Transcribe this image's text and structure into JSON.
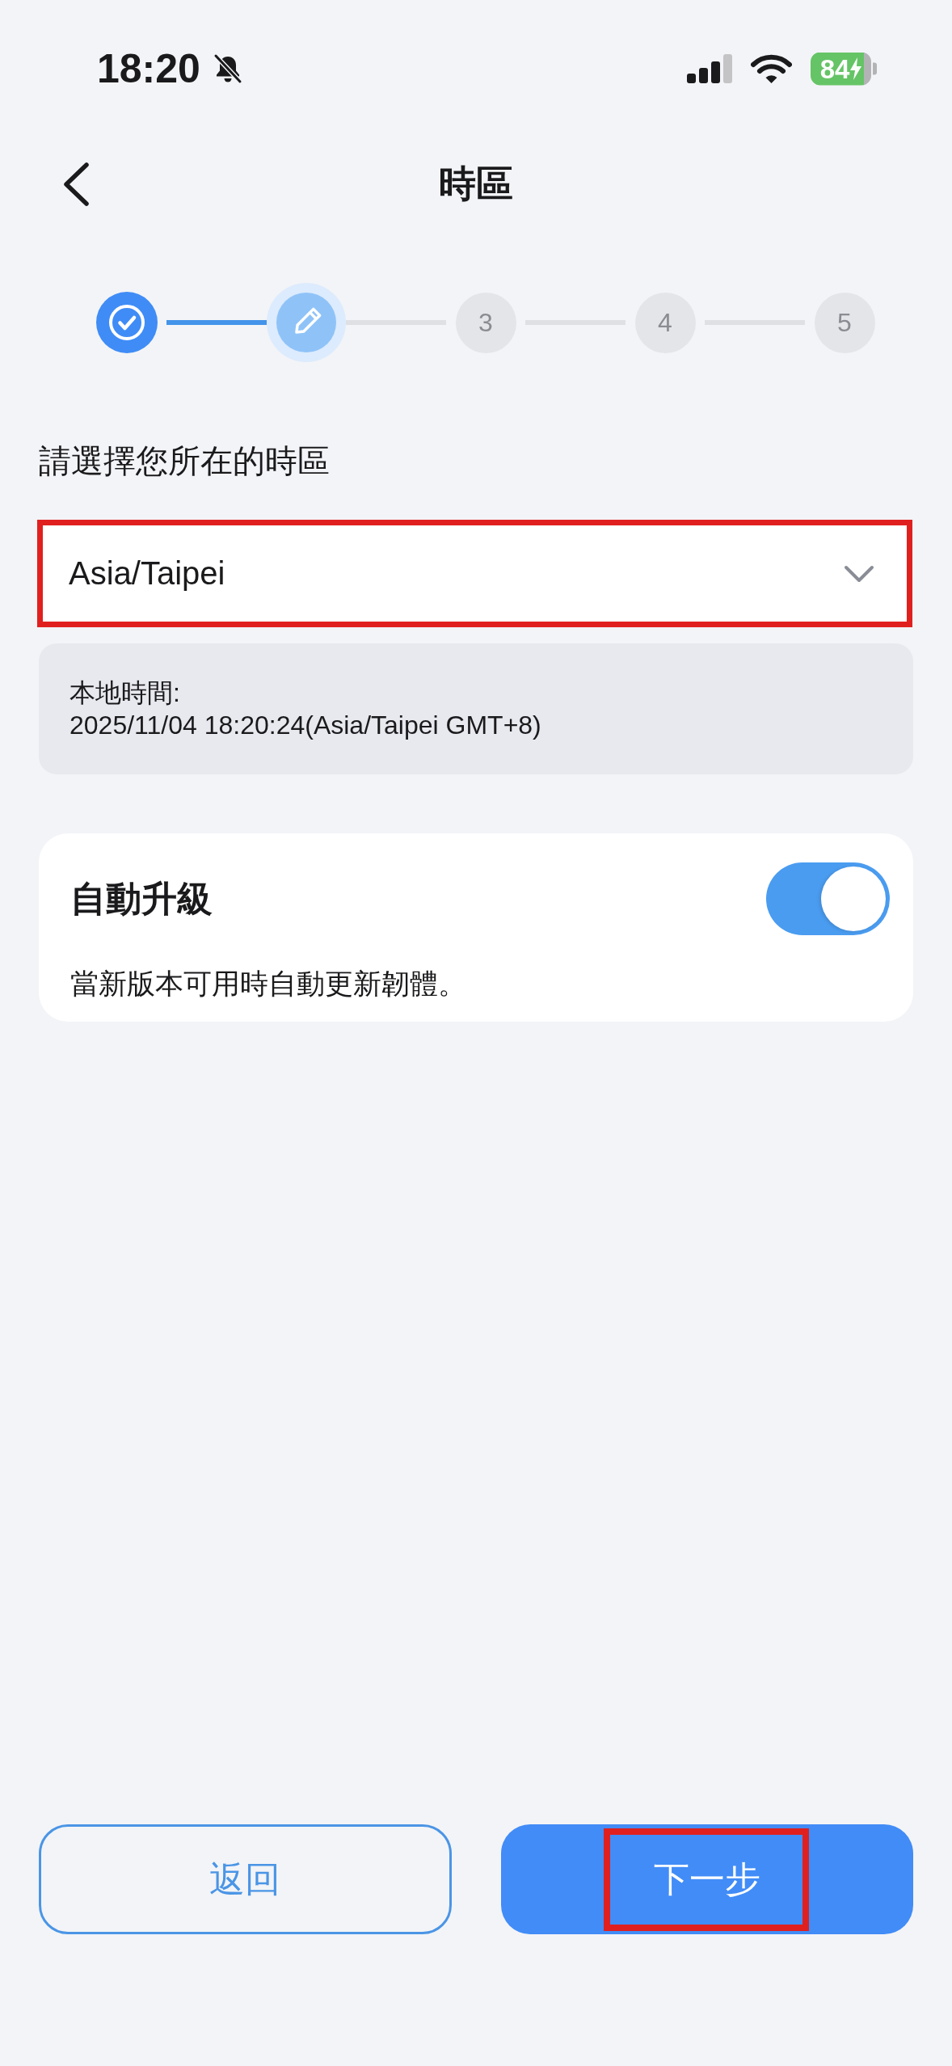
{
  "status_bar": {
    "time": "18:20",
    "silent": true,
    "battery": {
      "percent": "84",
      "charging": true
    }
  },
  "header": {
    "title": "時區"
  },
  "stepper": {
    "steps": [
      {
        "kind": "done"
      },
      {
        "kind": "current"
      },
      {
        "kind": "upcoming",
        "label": "3"
      },
      {
        "kind": "upcoming",
        "label": "4"
      },
      {
        "kind": "upcoming",
        "label": "5"
      }
    ]
  },
  "timezone": {
    "label": "請選擇您所在的時區",
    "value": "Asia/Taipei",
    "highlighted": true
  },
  "local_time": {
    "label": "本地時間:",
    "value": "2025/11/04 18:20:24(Asia/Taipei GMT+8)"
  },
  "auto_upgrade": {
    "title": "自動升級",
    "description": "當新版本可用時自動更新韌體。",
    "on": true
  },
  "buttons": [
    {
      "label": "返回",
      "kind": "secondary",
      "highlighted": false
    },
    {
      "label": "下一步",
      "kind": "primary",
      "highlighted": true
    }
  ]
}
